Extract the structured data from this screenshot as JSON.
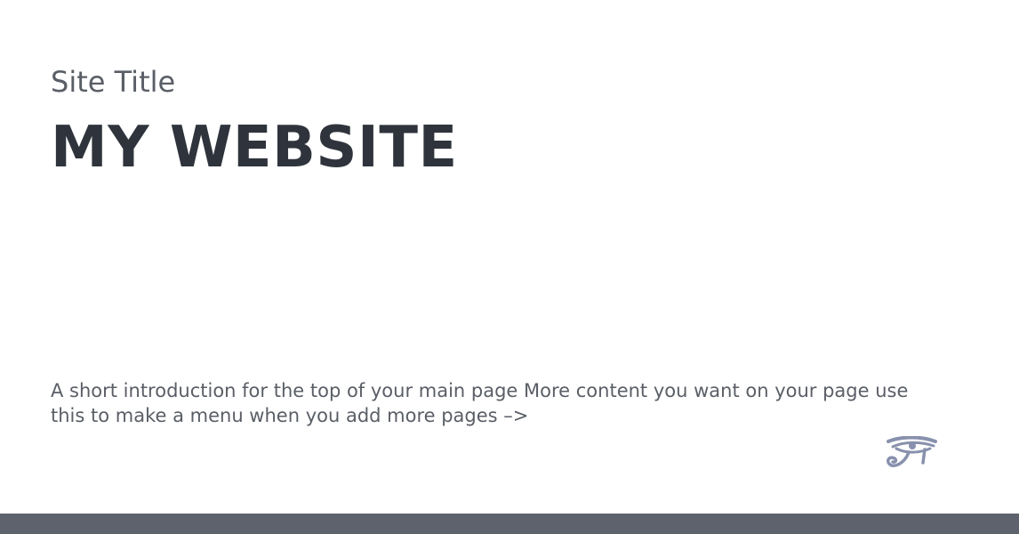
{
  "header": {
    "site_title": "Site Title",
    "main_heading": "MY WEBSITE"
  },
  "main": {
    "intro_text": "A short introduction for the top of your main page More content you want on your page use this to make a menu when you add more pages –>"
  },
  "logo": {
    "icon": "eye-of-horus-icon",
    "color": "#8891ad"
  },
  "footer": {
    "color": "#5d626c"
  },
  "colors": {
    "heading": "#2f343c",
    "text": "#5a5e66",
    "background": "#ffffff"
  }
}
